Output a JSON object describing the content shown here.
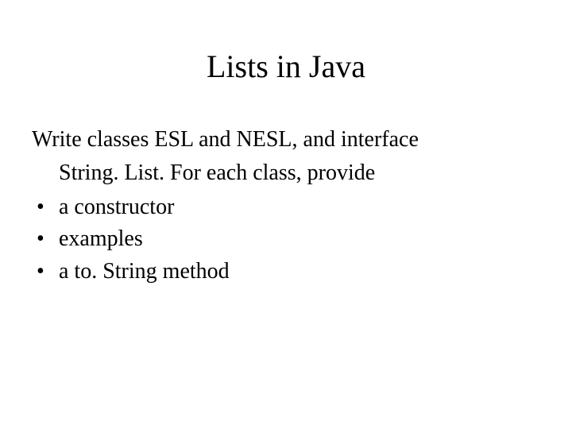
{
  "title": "Lists in Java",
  "intro_line1": "Write classes ESL and NESL, and interface",
  "intro_line2": "String. List.  For each class, provide",
  "bullets": {
    "b0": "a constructor",
    "b1": "examples",
    "b2": "a to. String method"
  }
}
